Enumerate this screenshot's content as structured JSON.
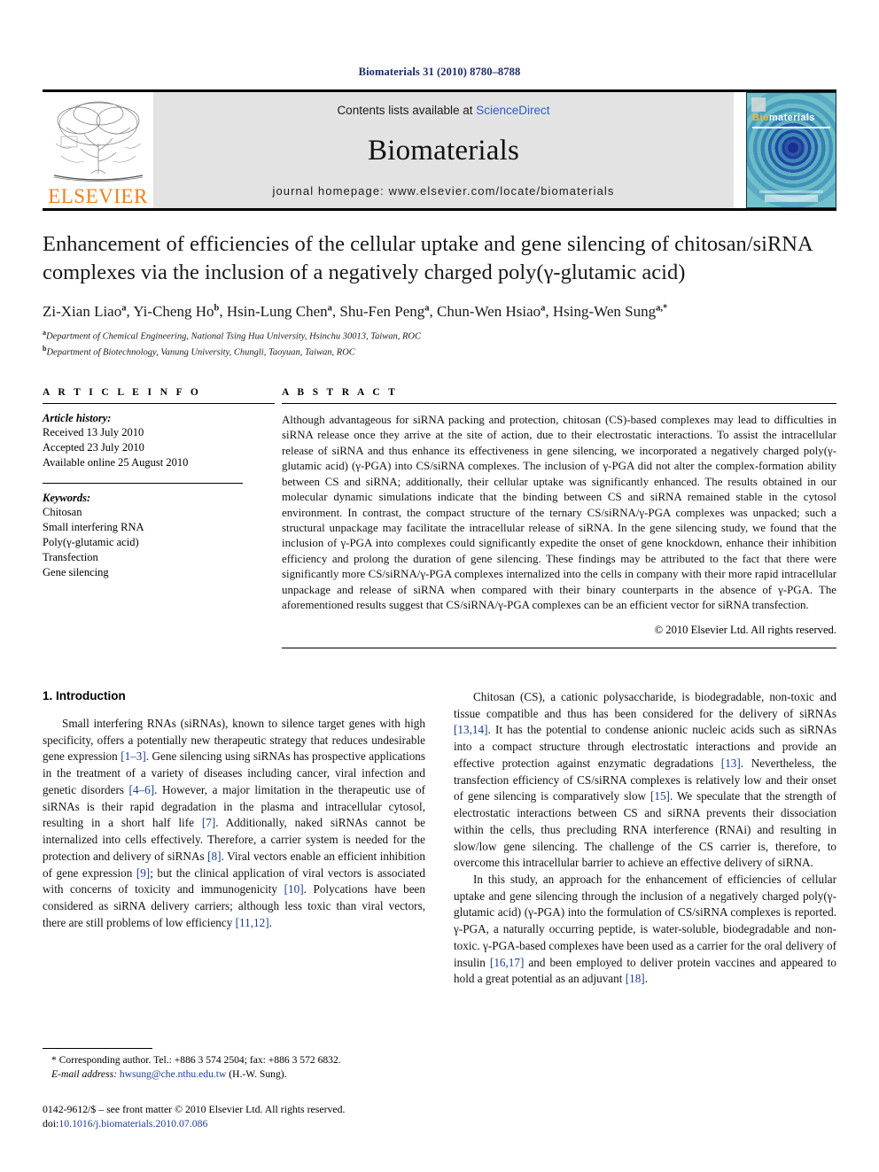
{
  "running_head": "Biomaterials 31 (2010) 8780–8788",
  "banner": {
    "publisher_name": "ELSEVIER",
    "contents_prefix": "Contents lists available at ",
    "sciencedirect": "ScienceDirect",
    "journal_name": "Biomaterials",
    "homepage": "journal homepage: www.elsevier.com/locate/biomaterials",
    "cover_title_bio": "Bio",
    "cover_title_materials": "materials",
    "sciencedirect_color": "#2b5ec4",
    "elsevier_orange": "#f07f1a"
  },
  "article": {
    "title": "Enhancement of efficiencies of the cellular uptake and gene silencing of chitosan/siRNA complexes via the inclusion of a negatively charged poly(γ-glutamic acid)",
    "authors": [
      {
        "name": "Zi-Xian Liao",
        "sup": "a"
      },
      {
        "name": "Yi-Cheng Ho",
        "sup": "b"
      },
      {
        "name": "Hsin-Lung Chen",
        "sup": "a"
      },
      {
        "name": "Shu-Fen Peng",
        "sup": "a"
      },
      {
        "name": "Chun-Wen Hsiao",
        "sup": "a"
      },
      {
        "name": "Hsing-Wen Sung",
        "sup": "a,*"
      }
    ],
    "affiliations": [
      {
        "sup": "a",
        "text": "Department of Chemical Engineering, National Tsing Hua University, Hsinchu 30013, Taiwan, ROC"
      },
      {
        "sup": "b",
        "text": "Department of Biotechnology, Vanung University, Chungli, Taoyuan, Taiwan, ROC"
      }
    ]
  },
  "article_info": {
    "heading": "A R T I C L E   I N F O",
    "history_label": "Article history:",
    "history": [
      "Received 13 July 2010",
      "Accepted 23 July 2010",
      "Available online 25 August 2010"
    ],
    "keywords_label": "Keywords:",
    "keywords": [
      "Chitosan",
      "Small interfering RNA",
      "Poly(γ-glutamic acid)",
      "Transfection",
      "Gene silencing"
    ]
  },
  "abstract": {
    "heading": "A B S T R A C T",
    "text": "Although advantageous for siRNA packing and protection, chitosan (CS)-based complexes may lead to difficulties in siRNA release once they arrive at the site of action, due to their electrostatic interactions. To assist the intracellular release of siRNA and thus enhance its effectiveness in gene silencing, we incorporated a negatively charged poly(γ-glutamic acid) (γ-PGA) into CS/siRNA complexes. The inclusion of γ-PGA did not alter the complex-formation ability between CS and siRNA; additionally, their cellular uptake was significantly enhanced. The results obtained in our molecular dynamic simulations indicate that the binding between CS and siRNA remained stable in the cytosol environment. In contrast, the compact structure of the ternary CS/siRNA/γ-PGA complexes was unpacked; such a structural unpackage may facilitate the intracellular release of siRNA. In the gene silencing study, we found that the inclusion of γ-PGA into complexes could significantly expedite the onset of gene knockdown, enhance their inhibition efficiency and prolong the duration of gene silencing. These findings may be attributed to the fact that there were significantly more CS/siRNA/γ-PGA complexes internalized into the cells in company with their more rapid intracellular unpackage and release of siRNA when compared with their binary counterparts in the absence of γ-PGA. The aforementioned results suggest that CS/siRNA/γ-PGA complexes can be an efficient vector for siRNA transfection.",
    "copyright": "© 2010 Elsevier Ltd. All rights reserved."
  },
  "introduction": {
    "heading": "1.  Introduction",
    "left_paragraph_1_a": "Small interfering RNAs (siRNAs), known to silence target genes with high specificity, offers a potentially new therapeutic strategy that reduces undesirable gene expression ",
    "ref_1_3": "[1–3]",
    "left_paragraph_1_b": ". Gene silencing using siRNAs has prospective applications in the treatment of a variety of diseases including cancer, viral infection and genetic disorders ",
    "ref_4_6": "[4–6]",
    "left_paragraph_1_c": ". However, a major limitation in the therapeutic use of siRNAs is their rapid degradation in the plasma and intracellular cytosol, resulting in a short half life ",
    "ref_7": "[7]",
    "left_paragraph_1_d": ". Additionally, naked siRNAs cannot be internalized into cells effectively. Therefore, a carrier system is needed for the protection and delivery of siRNAs ",
    "ref_8": "[8]",
    "left_paragraph_1_e": ". Viral vectors enable an efficient inhibition of gene expression ",
    "ref_9": "[9]",
    "left_paragraph_1_f": "; but the clinical application of viral vectors is associated with concerns of toxicity and immunogenicity ",
    "ref_10": "[10]",
    "left_paragraph_1_g": ". Polycations have been considered as siRNA delivery carriers; although less toxic than viral vectors, there are still problems of low efficiency ",
    "ref_11_12": "[11,12]",
    "left_paragraph_1_h": ".",
    "right_paragraph_1_a": "Chitosan (CS), a cationic polysaccharide, is biodegradable, non-toxic and tissue compatible and thus has been considered for the delivery of siRNAs ",
    "ref_13_14": "[13,14]",
    "right_paragraph_1_b": ". It has the potential to condense anionic nucleic acids such as siRNAs into a compact structure through electrostatic interactions and provide an effective protection against enzymatic degradations ",
    "ref_13": "[13]",
    "right_paragraph_1_c": ". Nevertheless, the transfection efficiency of CS/siRNA complexes is relatively low and their onset of gene silencing is comparatively slow ",
    "ref_15": "[15]",
    "right_paragraph_1_d": ". We speculate that the strength of electrostatic interactions between CS and siRNA prevents their dissociation within the cells, thus precluding RNA interference (RNAi) and resulting in slow/low gene silencing. The challenge of the CS carrier is, therefore, to overcome this intracellular barrier to achieve an effective delivery of siRNA.",
    "right_paragraph_2_a": "In this study, an approach for the enhancement of efficiencies of cellular uptake and gene silencing through the inclusion of a negatively charged poly(γ-glutamic acid) (γ-PGA) into the formulation of CS/siRNA complexes is reported. γ-PGA, a naturally occurring peptide, is water-soluble, biodegradable and non-toxic. γ-PGA-based complexes have been used as a carrier for the oral delivery of insulin ",
    "ref_16_17": "[16,17]",
    "right_paragraph_2_b": " and been employed to deliver protein vaccines and appeared to hold a great potential as an adjuvant ",
    "ref_18": "[18]",
    "right_paragraph_2_c": "."
  },
  "footnotes": {
    "corresponding": "* Corresponding author. Tel.: +886 3 574 2504; fax: +886 3 572 6832.",
    "email_label": "E-mail address:",
    "email": "hwsung@che.nthu.edu.tw",
    "email_suffix": "(H.-W. Sung).",
    "issn_line": "0142-9612/$ – see front matter © 2010 Elsevier Ltd. All rights reserved.",
    "doi_label": "doi:",
    "doi": "10.1016/j.biomaterials.2010.07.086"
  }
}
